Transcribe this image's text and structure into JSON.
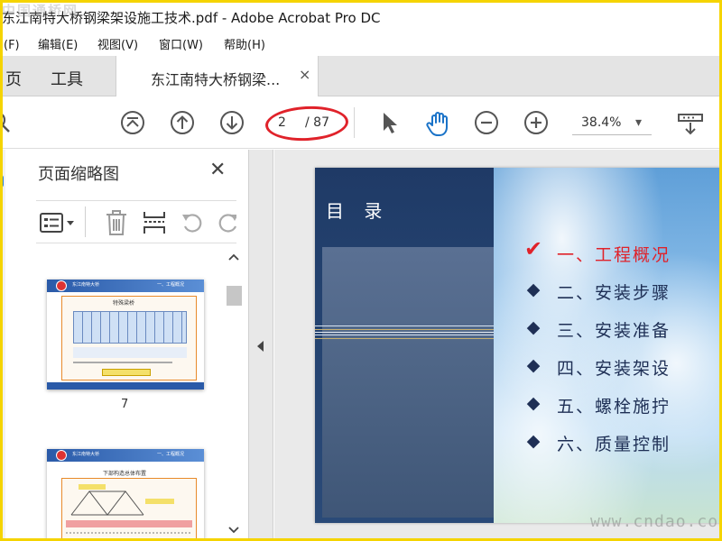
{
  "window": {
    "title": "东江南特大桥钢梁架设施工技术.pdf - Adobe Acrobat Pro DC",
    "watermark_top": "中国通桥网",
    "watermark_bottom": "www.cndao.com"
  },
  "menu": [
    "(F)",
    "编辑(E)",
    "视图(V)",
    "窗口(W)",
    "帮助(H)"
  ],
  "tabs": {
    "home": "页",
    "tools": "工具",
    "document": "东江南特大桥钢梁...",
    "close": "×"
  },
  "toolbar": {
    "current_page": "2",
    "total_pages": "/ 87",
    "zoom": "38.4%",
    "zoom_arrow": "▾"
  },
  "sidebar": {
    "title": "页面缩略图",
    "close": "✕",
    "thumbnails": [
      {
        "page": "7",
        "header_left": "东江南特大桥",
        "header_right": "一、工程概况",
        "caption": "特殊梁桥"
      },
      {
        "page": "",
        "header_left": "东江南特大桥",
        "header_right": "一、工程概况",
        "caption": "下部构造总体布置"
      }
    ]
  },
  "slide": {
    "title": "目 录",
    "items": [
      {
        "mark": "✔",
        "text": "一、工程概况",
        "active": true
      },
      {
        "mark": "◆",
        "text": "二、安装步骤",
        "active": false
      },
      {
        "mark": "◆",
        "text": "三、安装准备",
        "active": false
      },
      {
        "mark": "◆",
        "text": "四、安装架设",
        "active": false
      },
      {
        "mark": "◆",
        "text": "五、螺栓施拧",
        "active": false
      },
      {
        "mark": "◆",
        "text": "六、质量控制",
        "active": false
      }
    ]
  },
  "colors": {
    "highlight_oval": "#e0222a",
    "toc_active": "#e0222a",
    "toc_text": "#1e2f55",
    "frame": "#f5d400",
    "hand_tool": "#1a73c8"
  }
}
